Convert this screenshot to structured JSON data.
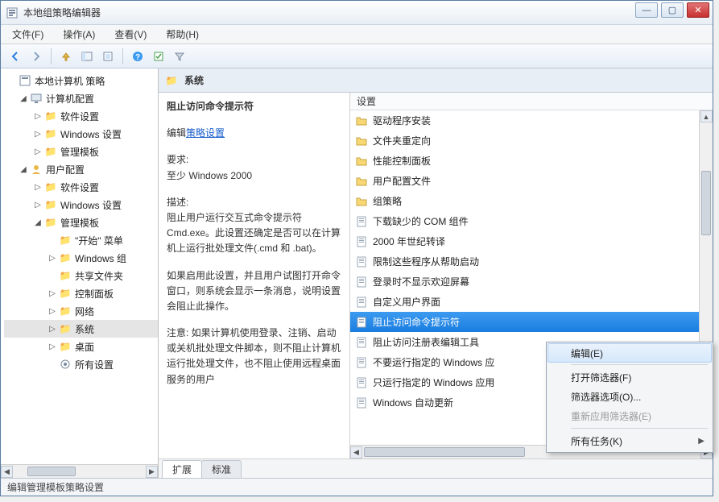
{
  "window": {
    "title": "本地组策略编辑器"
  },
  "menubar": {
    "file": "文件(F)",
    "action": "操作(A)",
    "view": "查看(V)",
    "help": "帮助(H)"
  },
  "tree": {
    "root": "本地计算机 策略",
    "computer": "计算机配置",
    "computer_software": "软件设置",
    "computer_windows": "Windows 设置",
    "computer_admin": "管理模板",
    "user": "用户配置",
    "user_software": "软件设置",
    "user_windows": "Windows 设置",
    "user_admin": "管理模板",
    "start_menu": "\"开始\" 菜单",
    "windows_comp": "Windows 组",
    "shared": "共享文件夹",
    "control_panel": "控制面板",
    "network": "网络",
    "system": "系统",
    "desktop": "桌面",
    "all_settings": "所有设置"
  },
  "header": {
    "title": "系统"
  },
  "detail": {
    "title": "阻止访问命令提示符",
    "edit_prefix": "编辑",
    "edit_link": "策略设置",
    "req_label": "要求:",
    "req": "至少 Windows 2000",
    "desc_label": "描述:",
    "desc1": "阻止用户运行交互式命令提示符 Cmd.exe。此设置还确定是否可以在计算机上运行批处理文件(.cmd 和 .bat)。",
    "desc2": "如果启用此设置，并且用户试图打开命令窗口，则系统会显示一条消息，说明设置会阻止此操作。",
    "desc3": "注意: 如果计算机使用登录、注销、启动或关机批处理文件脚本，则不阻止计算机运行批处理文件，也不阻止使用远程桌面服务的用户"
  },
  "settings": {
    "header": "设置",
    "items": [
      {
        "label": "驱动程序安装",
        "type": "folder"
      },
      {
        "label": "文件夹重定向",
        "type": "folder"
      },
      {
        "label": "性能控制面板",
        "type": "folder"
      },
      {
        "label": "用户配置文件",
        "type": "folder"
      },
      {
        "label": "组策略",
        "type": "folder"
      },
      {
        "label": "下载缺少的 COM 组件",
        "type": "setting"
      },
      {
        "label": "2000 年世纪转译",
        "type": "setting"
      },
      {
        "label": "限制这些程序从帮助启动",
        "type": "setting"
      },
      {
        "label": "登录时不显示欢迎屏幕",
        "type": "setting"
      },
      {
        "label": "自定义用户界面",
        "type": "setting"
      },
      {
        "label": "阻止访问命令提示符",
        "type": "setting",
        "selected": true
      },
      {
        "label": "阻止访问注册表编辑工具",
        "type": "setting"
      },
      {
        "label": "不要运行指定的 Windows 应",
        "type": "setting"
      },
      {
        "label": "只运行指定的 Windows 应用",
        "type": "setting"
      },
      {
        "label": "Windows 自动更新",
        "type": "setting"
      }
    ]
  },
  "tabs": {
    "extended": "扩展",
    "standard": "标准"
  },
  "status": "编辑管理模板策略设置",
  "context_menu": {
    "edit": "编辑(E)",
    "open_filter": "打开筛选器(F)",
    "filter_options": "筛选器选项(O)...",
    "reapply_filter": "重新应用筛选器(E)",
    "all_tasks": "所有任务(K)"
  }
}
